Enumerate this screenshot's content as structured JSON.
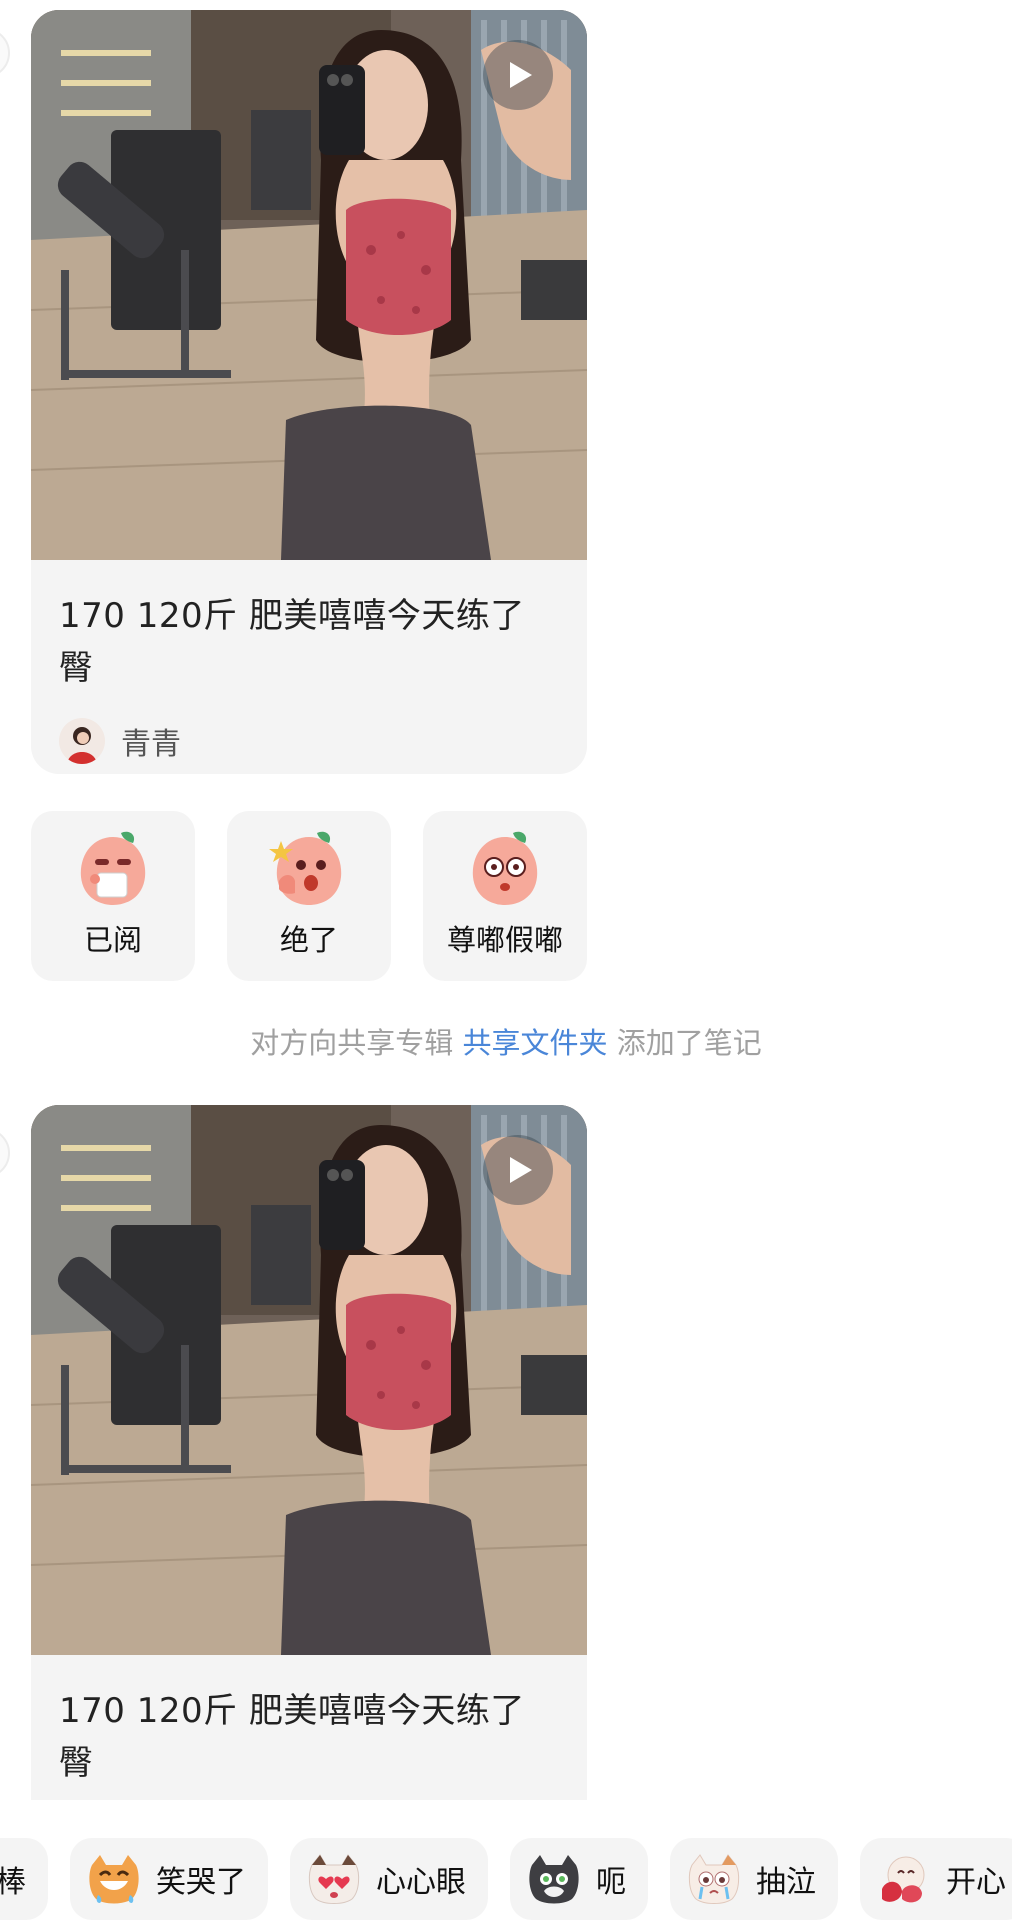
{
  "notes": [
    {
      "title": "170 120斤 肥美嘻嘻今天练了臀",
      "author": "青青",
      "media": "video"
    },
    {
      "title": "170 120斤 肥美嘻嘻今天练了臀",
      "media": "video"
    }
  ],
  "reactions": [
    {
      "label": "已阅",
      "icon": "peach-reading-icon"
    },
    {
      "label": "绝了",
      "icon": "peach-thumbs-up-icon"
    },
    {
      "label": "尊嘟假嘟",
      "icon": "peach-surprised-icon"
    }
  ],
  "system_message": {
    "prefix": "对方向共享专辑",
    "link": "共享文件夹",
    "suffix": "添加了笔记"
  },
  "sticker_bar": [
    {
      "label": "棒",
      "icon": "partial-sticker-icon"
    },
    {
      "label": "笑哭了",
      "icon": "laughing-cat-icon"
    },
    {
      "label": "心心眼",
      "icon": "heart-eyes-cat-icon"
    },
    {
      "label": "呃",
      "icon": "gray-cat-icon"
    },
    {
      "label": "抽泣",
      "icon": "sobbing-cat-icon"
    },
    {
      "label": "开心",
      "icon": "happy-sticker-icon"
    }
  ],
  "colors": {
    "card_bg": "#f4f4f4",
    "link": "#4a86d8",
    "muted_text": "#a0a0a0"
  }
}
